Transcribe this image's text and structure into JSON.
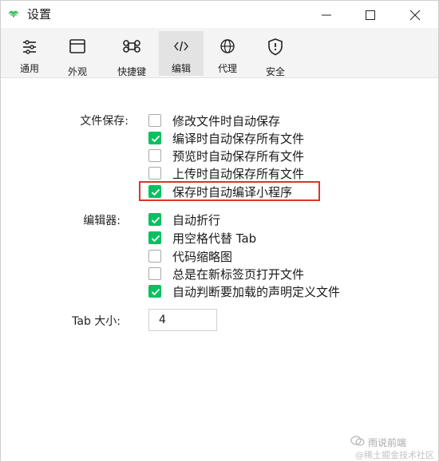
{
  "window": {
    "title": "设置"
  },
  "toolbar": {
    "items": [
      {
        "label": "通用",
        "icon": "sliders-icon",
        "active": false
      },
      {
        "label": "外观",
        "icon": "window-icon",
        "active": false
      },
      {
        "label": "快捷键",
        "icon": "command-icon",
        "active": false
      },
      {
        "label": "编辑",
        "icon": "code-icon",
        "active": true
      },
      {
        "label": "代理",
        "icon": "globe-icon",
        "active": false
      },
      {
        "label": "安全",
        "icon": "shield-icon",
        "active": false
      }
    ]
  },
  "file_save": {
    "label": "文件保存:",
    "options": [
      {
        "text": "修改文件时自动保存",
        "checked": false
      },
      {
        "text": "编译时自动保存所有文件",
        "checked": true
      },
      {
        "text": "预览时自动保存所有文件",
        "checked": false
      },
      {
        "text": "上传时自动保存所有文件",
        "checked": false
      },
      {
        "text": "保存时自动编译小程序",
        "checked": true
      }
    ]
  },
  "editor": {
    "label": "编辑器:",
    "options": [
      {
        "text": "自动折行",
        "checked": true
      },
      {
        "text": "用空格代替 Tab",
        "checked": true
      },
      {
        "text": "代码缩略图",
        "checked": false
      },
      {
        "text": "总是在新标签页打开文件",
        "checked": false
      },
      {
        "text": "自动判断要加载的声明定义文件",
        "checked": true
      }
    ]
  },
  "tab_size": {
    "label": "Tab 大小:",
    "value": "4"
  },
  "watermark": {
    "name": "雨说前端",
    "sub": "@稀土掘金技术社区"
  },
  "colors": {
    "check_green": "#07c160",
    "highlight_red": "#d9362b",
    "toolbar_bg": "#f4f4f4"
  }
}
